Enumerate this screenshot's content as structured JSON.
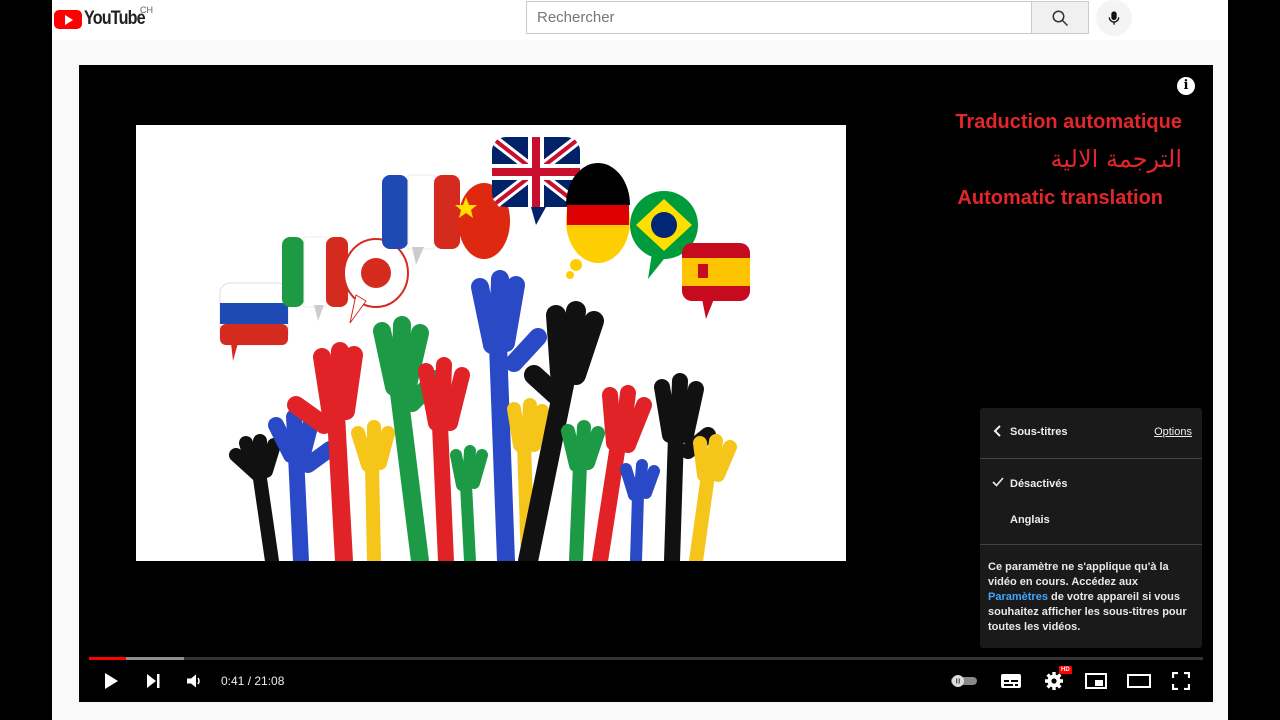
{
  "header": {
    "logo_text": "YouTube",
    "country_code": "CH",
    "search": {
      "placeholder": "Rechercher"
    }
  },
  "video": {
    "overlay_lines": [
      "Traduction automatique",
      "الترجمة الالية",
      "Automatic translation"
    ]
  },
  "settings_menu": {
    "title": "Sous-titres",
    "options_label": "Options",
    "items": [
      {
        "label": "Désactivés",
        "selected": true
      },
      {
        "label": "Anglais",
        "selected": false
      }
    ],
    "note_before": "Ce paramètre ne s'applique qu'à la vidéo en cours. Accédez aux ",
    "note_link": "Paramètres",
    "note_after": " de votre appareil si vous souhaitez afficher les sous-titres pour toutes les vidéos."
  },
  "controls": {
    "time_text": "0:41 / 21:08",
    "hd_badge": "HD",
    "progress_played_pct": 3.3,
    "progress_buffered_pct": 8.5
  },
  "colors": {
    "brand_red": "#ff0000",
    "caption_red": "#e3262a",
    "link_blue": "#3ea6ff"
  }
}
